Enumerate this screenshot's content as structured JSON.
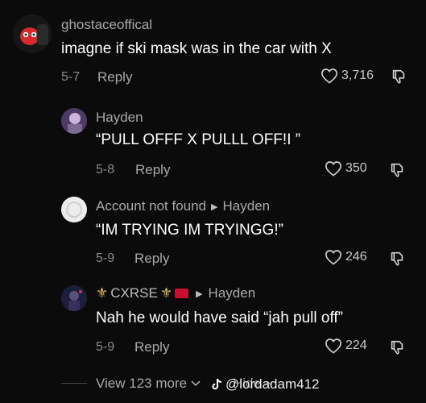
{
  "comments": [
    {
      "username": "ghostaceoffical",
      "reply_to": "",
      "text": "imagne if ski mask was in the car with X",
      "date": "5-7",
      "reply_label": "Reply",
      "likes": "3,716"
    },
    {
      "username": "Hayden",
      "reply_to": "",
      "text": "“PULL OFFF X PULLL OFF!I ”",
      "date": "5-8",
      "reply_label": "Reply",
      "likes": "350"
    },
    {
      "username": "Account not found",
      "reply_to": "Hayden",
      "text": "“IM TRYING IM TRYINGG!”",
      "date": "5-9",
      "reply_label": "Reply",
      "likes": "246"
    },
    {
      "username": "CXRSE",
      "reply_to": "Hayden",
      "text": "Nah he would have said “jah pull off”",
      "date": "5-9",
      "reply_label": "Reply",
      "likes": "224"
    }
  ],
  "footer": {
    "view_more": "View 123 more",
    "hide": "Hide",
    "watermark": "@lordadam412"
  },
  "colors": {
    "background": "#0b0b0b",
    "flag": "#c8102e"
  },
  "icons": [
    "heart-icon",
    "thumbs-down-icon",
    "chevron-down-icon",
    "arrow-right-icon",
    "fleur-de-lis-icon",
    "tiktok-icon"
  ]
}
